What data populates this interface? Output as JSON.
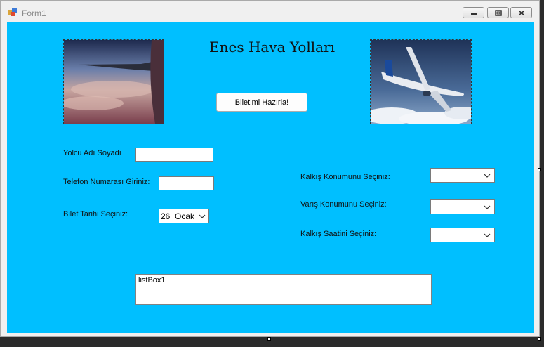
{
  "window": {
    "title": "Form1",
    "controls": [
      "minimize-icon",
      "maximize-icon",
      "close-icon"
    ]
  },
  "form": {
    "background_color": "#00bfff",
    "heading": "Enes Hava Yolları",
    "prepare_button_label": "Biletimi Hazırla!",
    "left_image": "airplane-wing-sky-photo",
    "right_image": "airliner-in-flight-photo"
  },
  "fields": {
    "name_label": "Yolcu Adı Soyadı",
    "name_value": "",
    "phone_label": "Telefon Numarası Giriniz:",
    "phone_value": "",
    "date_label": "Bilet Tarihi Seçiniz:",
    "date_day": "26",
    "date_month": "Ocak",
    "departure_label": "Kalkış Konumunu Seçiniz:",
    "departure_value": "",
    "arrival_label": "Varış Konumunu Seçiniz:",
    "arrival_value": "",
    "time_label": "Kalkış Saatini Seçiniz:",
    "time_value": ""
  },
  "listbox": {
    "items": [
      "listBox1"
    ]
  }
}
